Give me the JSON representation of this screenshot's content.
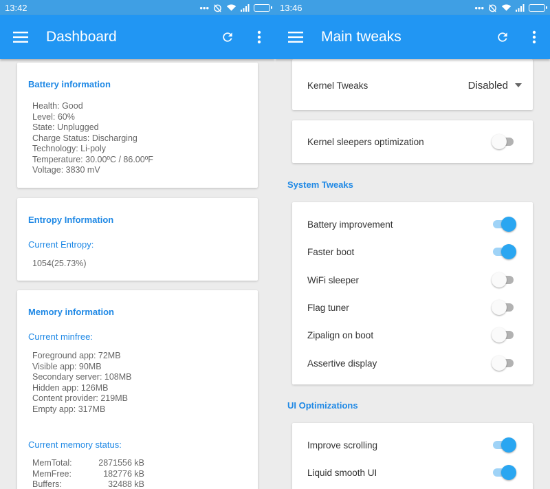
{
  "left": {
    "status_time": "13:42",
    "title": "Dashboard",
    "battery": {
      "title": "Battery information",
      "lines": [
        "Health: Good",
        "Level: 60%",
        "State: Unplugged",
        "Charge Status: Discharging",
        "Technology: Li-poly",
        "Temperature: 30.00ºC / 86.00ºF",
        "Voltage: 3830 mV"
      ]
    },
    "entropy": {
      "title": "Entropy Information",
      "subtitle": "Current Entropy:",
      "value": "1054(25.73%)"
    },
    "memory": {
      "title": "Memory information",
      "minfree_title": "Current minfree:",
      "minfree": [
        "Foreground app:  72MB",
        "Visible app:  90MB",
        "Secondary server:  108MB",
        "Hidden app:  126MB",
        "Content provider:  219MB",
        "Empty app:  317MB"
      ],
      "status_title": "Current memory status:",
      "status": [
        {
          "k": "MemTotal:",
          "v": "2871556 kB"
        },
        {
          "k": "MemFree:",
          "v": "182776 kB"
        },
        {
          "k": "Buffers:",
          "v": "32488 kB"
        }
      ]
    }
  },
  "right": {
    "status_time": "13:46",
    "title": "Main tweaks",
    "kernel_tweaks": {
      "label": "Kernel Tweaks",
      "value": "Disabled"
    },
    "kernel_sleepers": {
      "label": "Kernel sleepers optimization",
      "on": false
    },
    "system_section": "System Tweaks",
    "system": [
      {
        "label": "Battery improvement",
        "on": true
      },
      {
        "label": "Faster boot",
        "on": true
      },
      {
        "label": "WiFi sleeper",
        "on": false
      },
      {
        "label": "Flag tuner",
        "on": false
      },
      {
        "label": "Zipalign on boot",
        "on": false
      },
      {
        "label": "Assertive display",
        "on": false
      }
    ],
    "ui_section": "UI Optimizations",
    "ui": [
      {
        "label": "Improve scrolling",
        "on": true
      },
      {
        "label": "Liquid smooth UI",
        "on": true
      }
    ]
  },
  "icons": {
    "menu": "hamburger-menu-icon",
    "refresh": "refresh-icon",
    "more": "more-vert-icon",
    "status": [
      "notification-dots-icon",
      "alarm-off-icon",
      "wifi-icon",
      "signal-icon",
      "battery-icon"
    ]
  },
  "colors": {
    "appbar": "#2196f3",
    "statusbar": "#3f9fe4",
    "accent": "#1e88e5",
    "switch_on": "#2aa6f1"
  }
}
